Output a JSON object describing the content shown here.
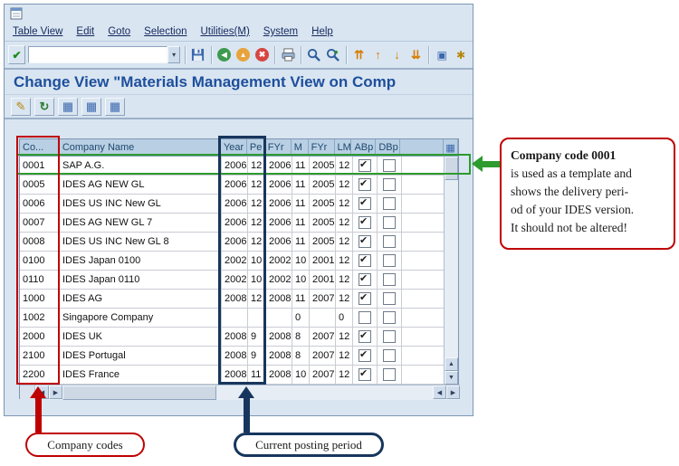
{
  "window": {
    "menu_items": [
      "Table View",
      "Edit",
      "Goto",
      "Selection",
      "Utilities(M)",
      "System",
      "Help"
    ],
    "toolbar": {
      "command_field_value": "",
      "glyphs": {
        "enter": "✔",
        "dropdown": "▾",
        "back": "◀",
        "exit": "▲",
        "cancel": "✖",
        "first_page": "⇈",
        "prev_page": "↑",
        "next_page": "↓",
        "last_page": "⇊",
        "new_session": "▣",
        "shortcut": "✱"
      }
    },
    "screen_title": "Change View \"Materials Management View on Comp",
    "app_toolbar": {
      "glyphs": {
        "display_change": "✎",
        "refresh": "↻",
        "table1": "▦",
        "table2": "▦",
        "table3": "▦"
      }
    },
    "table": {
      "columns": [
        "Co...",
        "Company Name",
        "Year",
        "Pe",
        "FYr",
        "M",
        "FYr",
        "LM",
        "ABp",
        "DBp"
      ],
      "config_glyph": "▦",
      "rows": [
        {
          "co": "0001",
          "name": "SAP A.G.",
          "year": "2006",
          "pe": "12",
          "fyr1": "2006",
          "m": "11",
          "fyr2": "2005",
          "lm": "12",
          "abp": true,
          "dbp": false
        },
        {
          "co": "0005",
          "name": "IDES AG NEW GL",
          "year": "2006",
          "pe": "12",
          "fyr1": "2006",
          "m": "11",
          "fyr2": "2005",
          "lm": "12",
          "abp": true,
          "dbp": false
        },
        {
          "co": "0006",
          "name": "IDES US INC New GL",
          "year": "2006",
          "pe": "12",
          "fyr1": "2006",
          "m": "11",
          "fyr2": "2005",
          "lm": "12",
          "abp": true,
          "dbp": false
        },
        {
          "co": "0007",
          "name": "IDES AG NEW GL 7",
          "year": "2006",
          "pe": "12",
          "fyr1": "2006",
          "m": "11",
          "fyr2": "2005",
          "lm": "12",
          "abp": true,
          "dbp": false
        },
        {
          "co": "0008",
          "name": "IDES US INC New GL 8",
          "year": "2006",
          "pe": "12",
          "fyr1": "2006",
          "m": "11",
          "fyr2": "2005",
          "lm": "12",
          "abp": true,
          "dbp": false
        },
        {
          "co": "0100",
          "name": "IDES Japan 0100",
          "year": "2002",
          "pe": "10",
          "fyr1": "2002",
          "m": "10",
          "fyr2": "2001",
          "lm": "12",
          "abp": true,
          "dbp": false
        },
        {
          "co": "0110",
          "name": "IDES Japan 0110",
          "year": "2002",
          "pe": "10",
          "fyr1": "2002",
          "m": "10",
          "fyr2": "2001",
          "lm": "12",
          "abp": true,
          "dbp": false
        },
        {
          "co": "1000",
          "name": "IDES AG",
          "year": "2008",
          "pe": "12",
          "fyr1": "2008",
          "m": "11",
          "fyr2": "2007",
          "lm": "12",
          "abp": true,
          "dbp": false
        },
        {
          "co": "1002",
          "name": "Singapore Company",
          "year": "",
          "pe": "",
          "fyr1": "",
          "m": "0",
          "fyr2": "",
          "lm": "0",
          "abp": false,
          "dbp": false
        },
        {
          "co": "2000",
          "name": "IDES UK",
          "year": "2008",
          "pe": "9",
          "fyr1": "2008",
          "m": "8",
          "fyr2": "2007",
          "lm": "12",
          "abp": true,
          "dbp": false
        },
        {
          "co": "2100",
          "name": "IDES Portugal",
          "year": "2008",
          "pe": "9",
          "fyr1": "2008",
          "m": "8",
          "fyr2": "2007",
          "lm": "12",
          "abp": true,
          "dbp": false
        },
        {
          "co": "2200",
          "name": "IDES France",
          "year": "2008",
          "pe": "11",
          "fyr1": "2008",
          "m": "10",
          "fyr2": "2007",
          "lm": "12",
          "abp": true,
          "dbp": false
        }
      ]
    },
    "scrollbar_glyphs": {
      "up": "▲",
      "down": "▼",
      "left": "◀",
      "right": "▶"
    }
  },
  "annotations": {
    "template_note": {
      "title": "Company code 0001",
      "lines": [
        "is used as a template and",
        "shows the delivery peri-",
        "od of your IDES version.",
        "It should not be altered!"
      ]
    },
    "company_codes_label": "Company codes",
    "posting_period_label": "Current posting period",
    "colors": {
      "red": "#bf0000",
      "green": "#2e9b2e",
      "navy": "#17365d",
      "title_blue": "#1e4f9c"
    }
  }
}
